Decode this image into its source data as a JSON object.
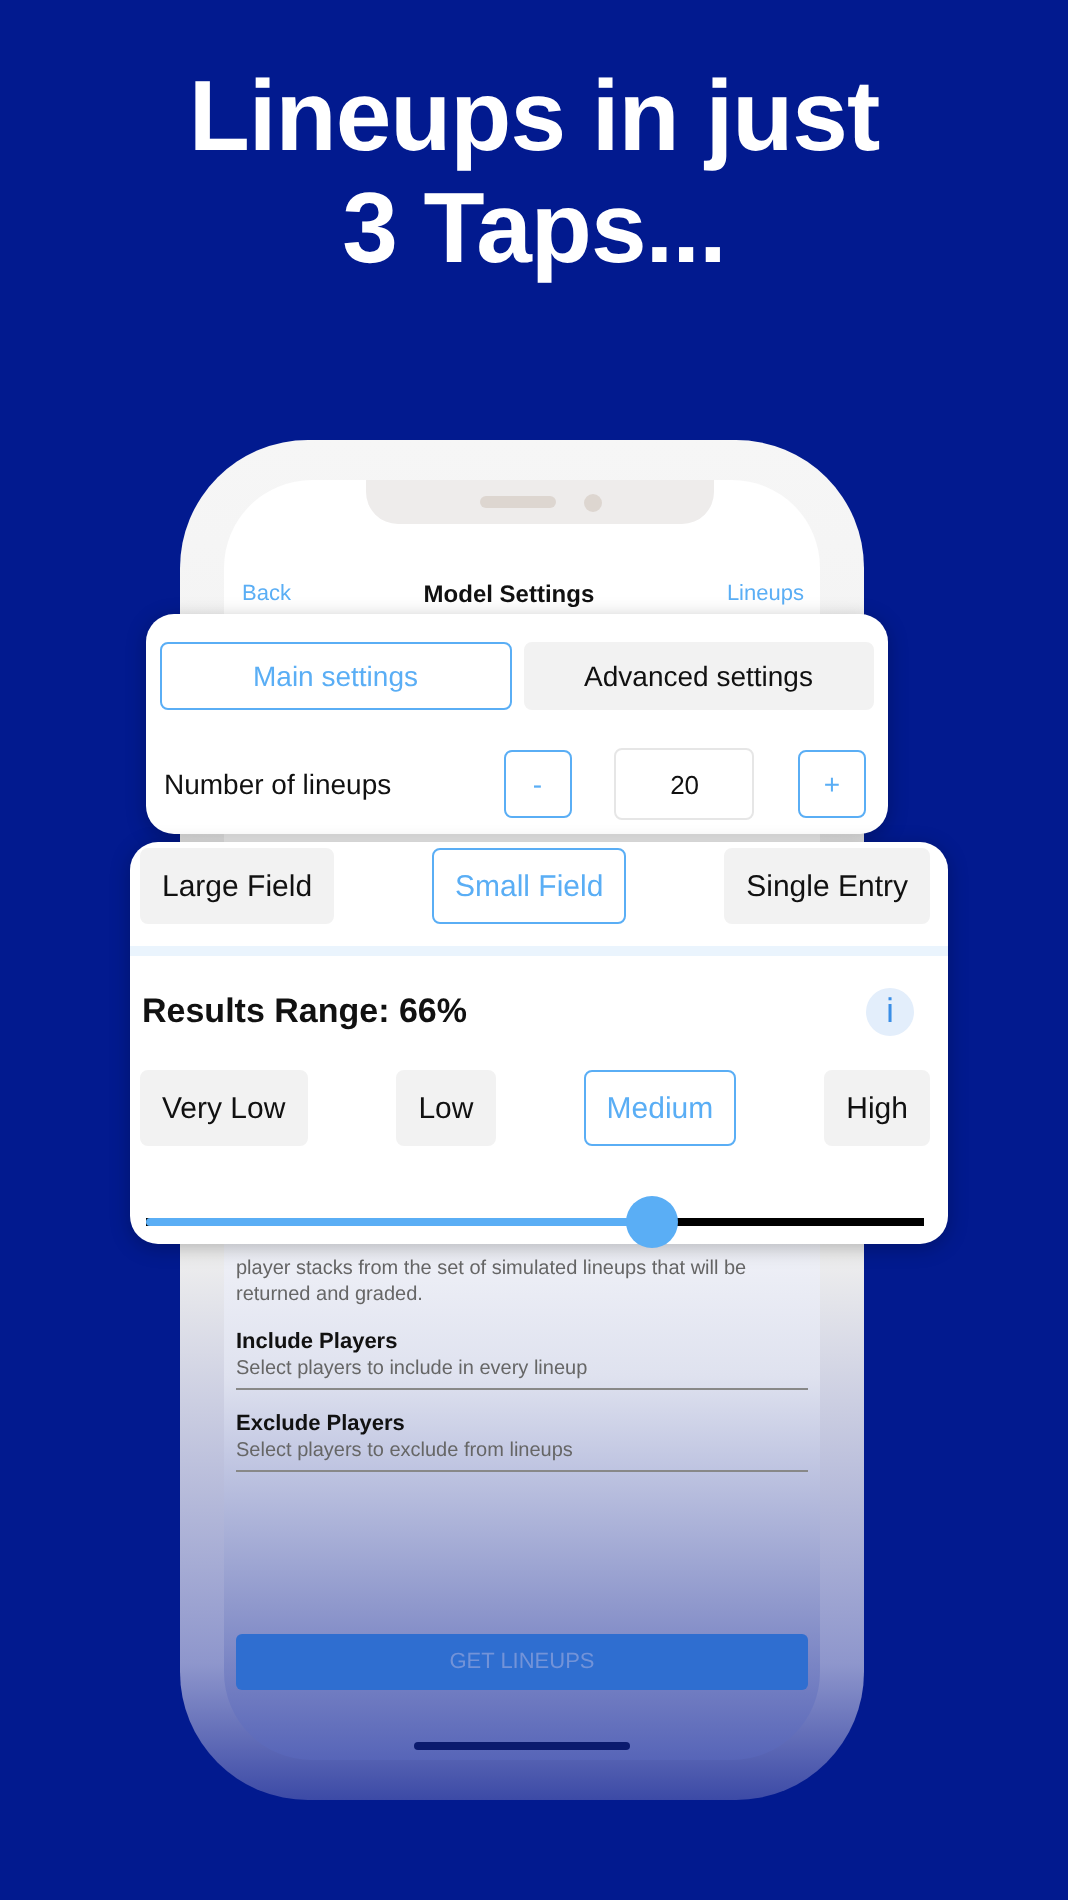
{
  "headline": [
    "Lineups in just",
    "3 Taps..."
  ],
  "nav": {
    "back": "Back",
    "title": "Model Settings",
    "action": "Lineups"
  },
  "tabs": [
    {
      "label": "Main settings",
      "selected": true
    },
    {
      "label": "Advanced settings",
      "selected": false
    }
  ],
  "lineups": {
    "label": "Number of lineups",
    "minus": "-",
    "value": "20",
    "plus": "+"
  },
  "contest_fields": [
    {
      "label": "Large Field",
      "selected": false
    },
    {
      "label": "Small Field",
      "selected": true
    },
    {
      "label": "Single Entry",
      "selected": false
    }
  ],
  "results_range": {
    "label": "Results Range: 66%",
    "info": "i",
    "level": 0.65,
    "options": [
      {
        "label": "Very Low",
        "selected": false
      },
      {
        "label": "Low",
        "selected": false
      },
      {
        "label": "Medium",
        "selected": true
      },
      {
        "label": "High",
        "selected": false
      }
    ]
  },
  "description": "player stacks from the set of simulated lineups that will be returned and graded.",
  "filters": [
    {
      "title": "Include Players",
      "hint": "Select players to include in every lineup"
    },
    {
      "title": "Exclude Players",
      "hint": "Select players to exclude from lineups"
    }
  ],
  "submit": "GET LINEUPS"
}
